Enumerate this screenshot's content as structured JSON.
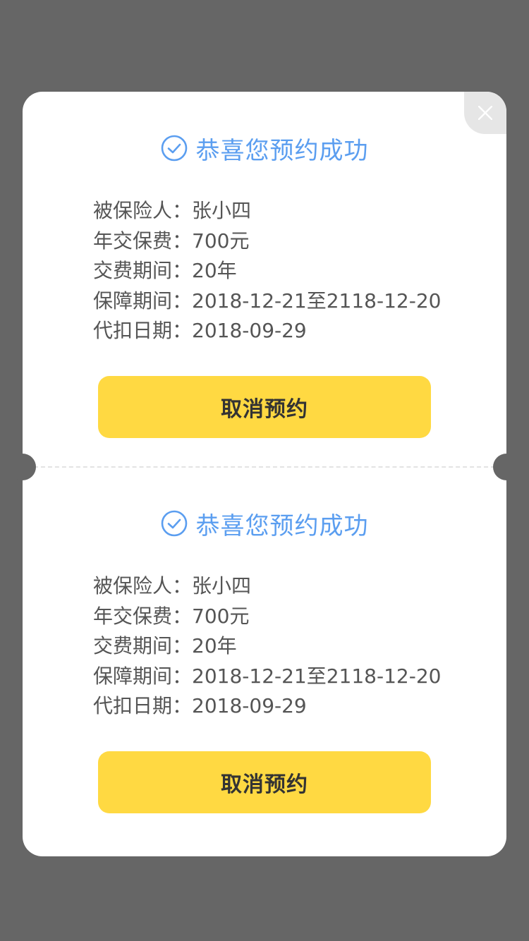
{
  "colors": {
    "overlay": "#666666",
    "card": "#ffffff",
    "accent": "#5b9ef0",
    "button": "#ffd942",
    "text": "#555555"
  },
  "close_icon": "close-icon",
  "reservations": [
    {
      "title": "恭喜您预约成功",
      "icon": "check-circle-icon",
      "insured_label": "被保险人：",
      "insured_value": "张小四",
      "premium_label": "年交保费：",
      "premium_value": "700元",
      "pay_period_label": "交费期间：",
      "pay_period_value": "20年",
      "coverage_label": "保障期间：",
      "coverage_value": "2018-12-21至2118-12-20",
      "debit_date_label": "代扣日期：",
      "debit_date_value": "2018-09-29",
      "cancel_label": "取消预约"
    },
    {
      "title": "恭喜您预约成功",
      "icon": "check-circle-icon",
      "insured_label": "被保险人：",
      "insured_value": "张小四",
      "premium_label": "年交保费：",
      "premium_value": "700元",
      "pay_period_label": "交费期间：",
      "pay_period_value": "20年",
      "coverage_label": "保障期间：",
      "coverage_value": "2018-12-21至2118-12-20",
      "debit_date_label": "代扣日期：",
      "debit_date_value": "2018-09-29",
      "cancel_label": "取消预约"
    }
  ]
}
